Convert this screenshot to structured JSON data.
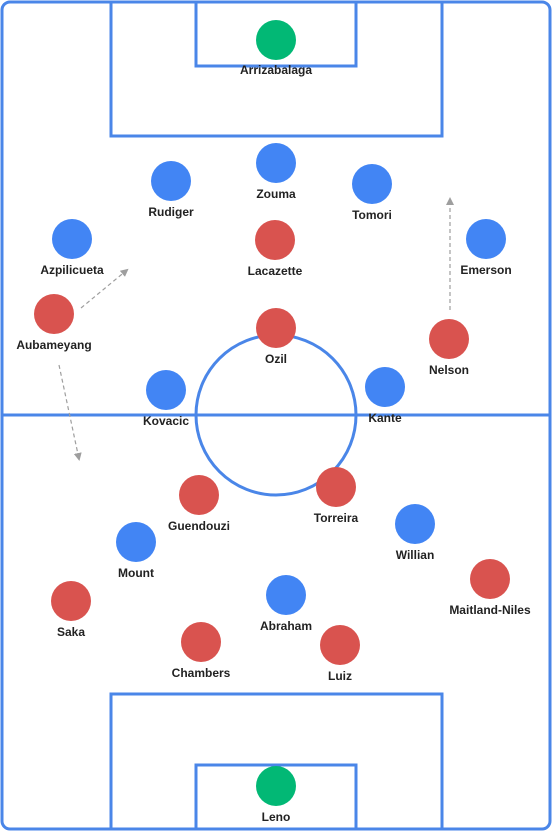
{
  "colors": {
    "field_lines": "#4a86e8",
    "team_blue": "#4285f4",
    "team_red": "#d9534f",
    "goalkeeper": "#02b875",
    "arrow": "#9e9e9e",
    "label": "#222222"
  },
  "players": [
    {
      "name": "Arrizabalaga",
      "team": "goalkeeper"
    },
    {
      "name": "Zouma",
      "team": "blue"
    },
    {
      "name": "Rudiger",
      "team": "blue"
    },
    {
      "name": "Tomori",
      "team": "blue"
    },
    {
      "name": "Azpilicueta",
      "team": "blue"
    },
    {
      "name": "Emerson",
      "team": "blue"
    },
    {
      "name": "Lacazette",
      "team": "red"
    },
    {
      "name": "Aubameyang",
      "team": "red"
    },
    {
      "name": "Ozil",
      "team": "red"
    },
    {
      "name": "Nelson",
      "team": "red"
    },
    {
      "name": "Kovacic",
      "team": "blue"
    },
    {
      "name": "Kante",
      "team": "blue"
    },
    {
      "name": "Guendouzi",
      "team": "red"
    },
    {
      "name": "Torreira",
      "team": "red"
    },
    {
      "name": "Willian",
      "team": "blue"
    },
    {
      "name": "Mount",
      "team": "blue"
    },
    {
      "name": "Maitland-Niles",
      "team": "red"
    },
    {
      "name": "Saka",
      "team": "red"
    },
    {
      "name": "Abraham",
      "team": "blue"
    },
    {
      "name": "Chambers",
      "team": "red"
    },
    {
      "name": "Luiz",
      "team": "red"
    },
    {
      "name": "Leno",
      "team": "goalkeeper"
    }
  ],
  "movement_arrows": [
    {
      "from_player": "Aubameyang",
      "direction": "up-right"
    },
    {
      "from_player": "Aubameyang",
      "direction": "down"
    },
    {
      "from_player": "Nelson",
      "direction": "up"
    }
  ]
}
